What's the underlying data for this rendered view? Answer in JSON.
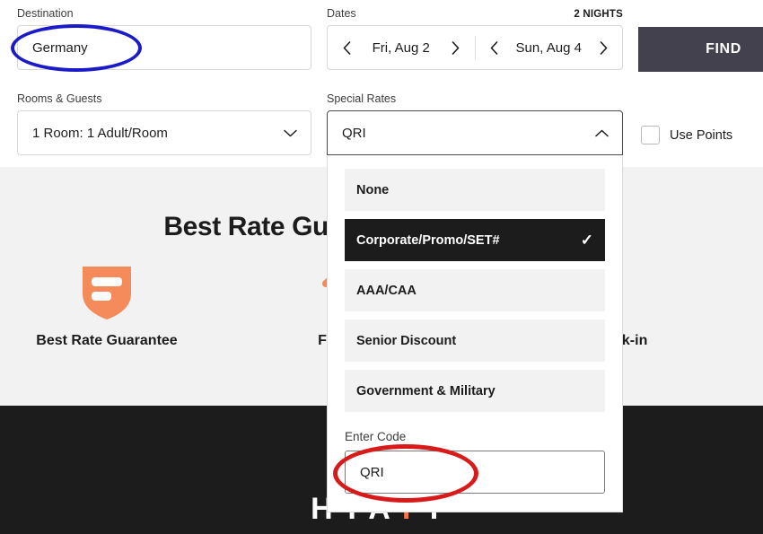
{
  "search": {
    "destination": {
      "label": "Destination",
      "value": "Germany"
    },
    "dates": {
      "label": "Dates",
      "nights": "2 NIGHTS",
      "check_in": "Fri, Aug 2",
      "check_out": "Sun, Aug 4",
      "prev_icon": "chevron-left-icon",
      "next_icon": "chevron-right-icon"
    },
    "find_button": "FIND",
    "rooms": {
      "label": "Rooms & Guests",
      "value": "1 Room: 1 Adult/Room",
      "caret_icon": "chevron-down-icon"
    },
    "special_rates": {
      "label": "Special Rates",
      "value": "QRI",
      "caret_icon": "chevron-up-icon",
      "options": [
        {
          "label": "None",
          "selected": false
        },
        {
          "label": "Corporate/Promo/SET#",
          "selected": true
        },
        {
          "label": "AAA/CAA",
          "selected": false
        },
        {
          "label": "Senior Discount",
          "selected": false
        },
        {
          "label": "Government & Military",
          "selected": false
        }
      ],
      "check_glyph": "✓",
      "code_label": "Enter Code",
      "code_value": "QRI"
    },
    "use_points": {
      "label": "Use Points",
      "checked": false
    }
  },
  "promo": {
    "headline": "Best Rate Guaranteed at hyatt.com",
    "features": [
      {
        "label": "Best Rate Guarantee",
        "icon": "shield-icon"
      },
      {
        "label": "Free WiFi",
        "icon": "wifi-icon"
      },
      {
        "label": "Mobile Check-in",
        "icon": "phone-icon"
      }
    ]
  },
  "footer": {
    "logo_left": "H",
    "logo_mid": "YA",
    "logo_accent": "T",
    "logo_right": "T"
  },
  "annotations": [
    {
      "name": "destination-highlight",
      "color": "#1a1ac8",
      "shape": "ellipse"
    },
    {
      "name": "enter-code-highlight",
      "color": "#d81a1a",
      "shape": "ellipse"
    }
  ],
  "colors": {
    "find_button_bg": "#44414f",
    "selected_option_bg": "#1c1c1c",
    "option_bg": "#f2f2f2",
    "band_bg": "#f2f2f2",
    "footer_bg": "#1c1c1c",
    "brand_orange": "#f2784b"
  }
}
